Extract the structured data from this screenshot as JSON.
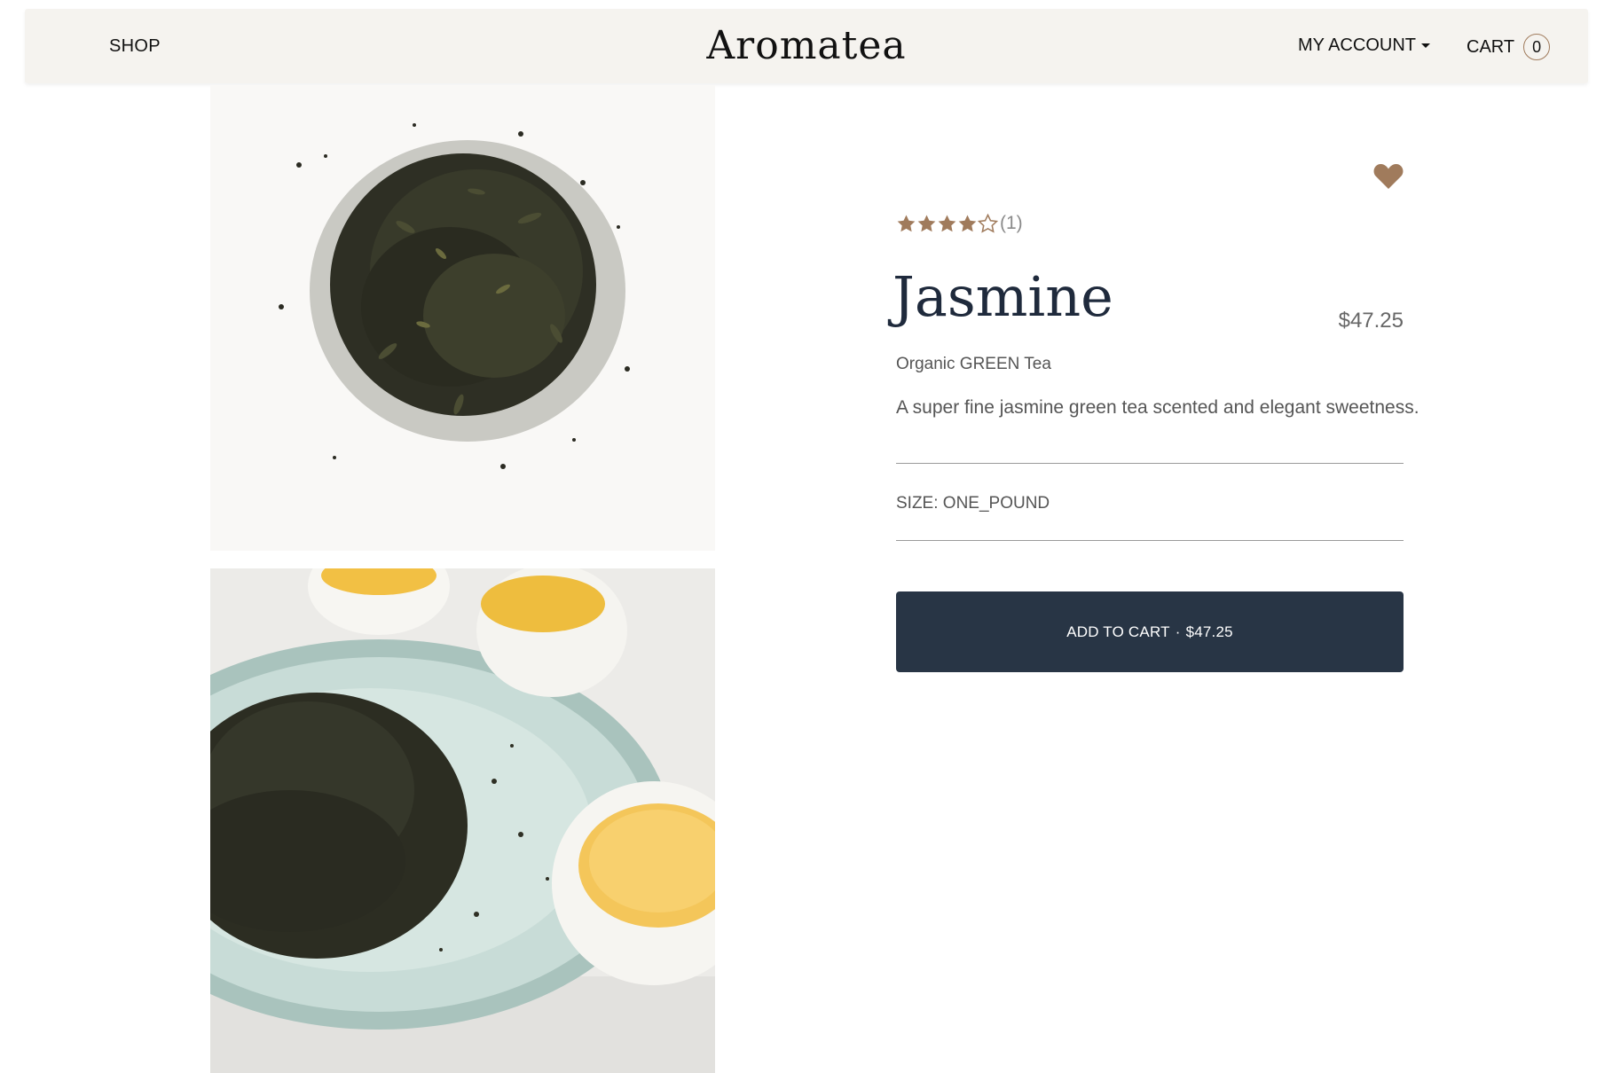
{
  "header": {
    "shop_label": "SHOP",
    "logo_text": "Aromatea",
    "account_label": "MY ACCOUNT",
    "cart_label": "CART",
    "cart_count": "0"
  },
  "gallery": {
    "images": [
      {
        "icon": "loose-tea-leaves-image"
      },
      {
        "icon": "tea-leaves-plate-with-cups-image"
      }
    ]
  },
  "product": {
    "favorite_icon": "heart-icon",
    "rating": {
      "stars_filled": 4,
      "stars_total": 5,
      "count_text": "(1)"
    },
    "name": "Jasmine",
    "price": "$47.25",
    "category": "Organic GREEN Tea",
    "description": "A super fine jasmine green tea scented and elegant sweetness.",
    "size_text": "SIZE: ONE_POUND",
    "add_to_cart": {
      "label": "ADD TO CART",
      "separator": "·",
      "price": "$47.25"
    }
  },
  "colors": {
    "accent": "#a07b5c",
    "header_bg": "#f5f3ef",
    "button_bg": "#283545",
    "title": "#1f2a3c"
  }
}
